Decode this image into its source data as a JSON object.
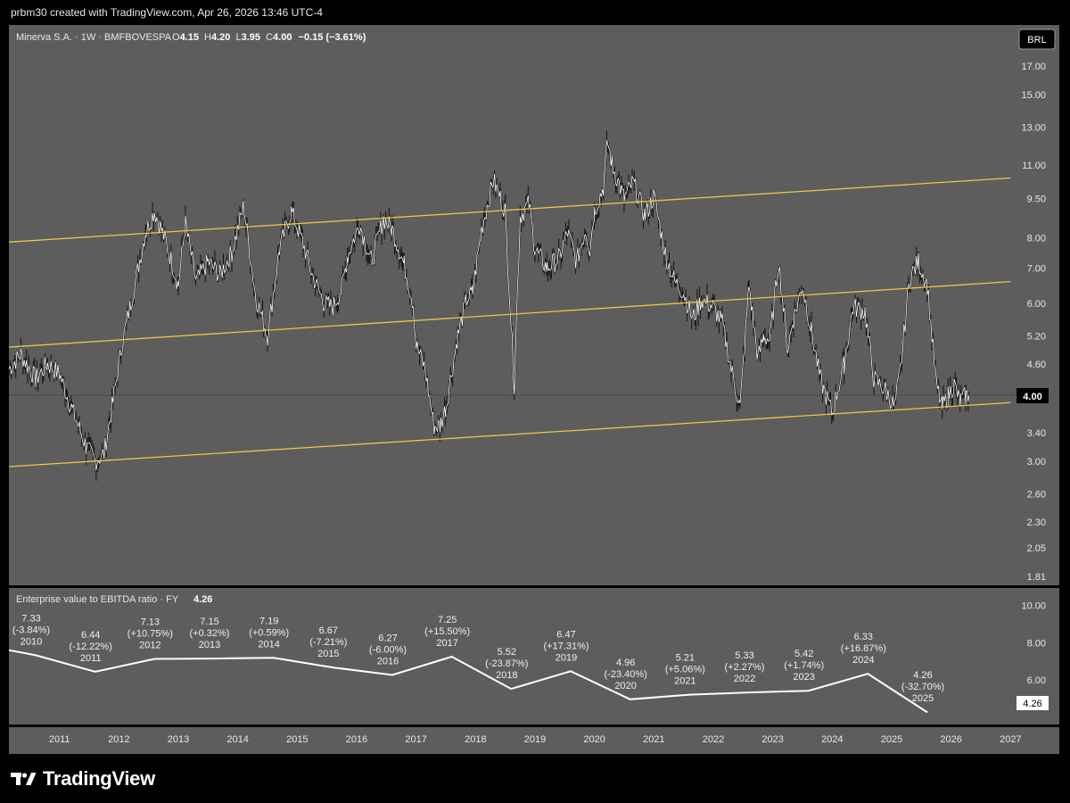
{
  "header": {
    "credit": "prbm30 created with TradingView.com, Apr 26, 2026 13:46 UTC-4"
  },
  "brand": {
    "name": "TradingView",
    "icon": "tradingview-logo-icon"
  },
  "colors": {
    "background": "#000000",
    "pane": "#5d5d5d",
    "price_line": "#ffffff",
    "candle": "#111111",
    "channel": "#e6c84a",
    "text": "#e8e8e8"
  },
  "price_pane": {
    "legend": {
      "symbol": "Minerva S.A. · 1W · BMFBOVESPA",
      "o_label": "O",
      "o_value": "4.15",
      "h_label": "H",
      "h_value": "4.20",
      "l_label": "L",
      "l_value": "3.95",
      "c_label": "C",
      "c_value": "4.00",
      "change": "−0.15 (−3.61%)"
    },
    "currency_button": "BRL",
    "last_price_label": "4.00",
    "y_ticks": [
      "17.00",
      "15.00",
      "13.00",
      "11.00",
      "9.50",
      "8.00",
      "7.00",
      "6.00",
      "5.20",
      "4.60",
      "4.00",
      "3.40",
      "3.00",
      "2.60",
      "2.30",
      "2.05",
      "1.81"
    ]
  },
  "indicator_pane": {
    "legend_name": "Enterprise value to EBITDA ratio · FY",
    "legend_value": "4.26",
    "last_value_label": "4.26",
    "y_ticks": [
      "10.00",
      "8.00",
      "6.00"
    ]
  },
  "x_ticks": [
    "2011",
    "2012",
    "2013",
    "2014",
    "2015",
    "2016",
    "2017",
    "2018",
    "2019",
    "2020",
    "2021",
    "2022",
    "2023",
    "2024",
    "2025",
    "2026",
    "2027"
  ],
  "chart_data": [
    {
      "type": "candlestick",
      "title": "Minerva S.A. · 1W · BMFBOVESPA",
      "currency": "BRL",
      "y_scale": "log",
      "ylim": [
        1.81,
        17.0
      ],
      "xlim": [
        2010.15,
        2027.1
      ],
      "grid": false,
      "last_price": 4.0,
      "price_series": {
        "x": [
          2010.15,
          2010.35,
          2010.6,
          2010.8,
          2011.0,
          2011.2,
          2011.45,
          2011.6,
          2011.75,
          2011.9,
          2012.05,
          2012.2,
          2012.45,
          2012.6,
          2012.8,
          2013.0,
          2013.12,
          2013.3,
          2013.5,
          2013.7,
          2013.9,
          2014.1,
          2014.3,
          2014.5,
          2014.7,
          2014.9,
          2015.1,
          2015.25,
          2015.45,
          2015.6,
          2015.75,
          2015.85,
          2016.05,
          2016.25,
          2016.45,
          2016.6,
          2016.8,
          2016.95,
          2017.0,
          2017.15,
          2017.3,
          2017.4,
          2017.5,
          2017.7,
          2017.85,
          2017.95,
          2018.1,
          2018.3,
          2018.5,
          2018.65,
          2018.75,
          2018.9,
          2019.0,
          2019.2,
          2019.4,
          2019.55,
          2019.7,
          2019.85,
          2019.92,
          2020.0,
          2020.15,
          2020.22,
          2020.3,
          2020.5,
          2020.65,
          2020.85,
          2021.0,
          2021.2,
          2021.35,
          2021.5,
          2021.65,
          2021.8,
          2022.0,
          2022.15,
          2022.3,
          2022.45,
          2022.6,
          2022.75,
          2022.85,
          2022.95,
          2023.1,
          2023.25,
          2023.35,
          2023.5,
          2023.65,
          2023.8,
          2024.0,
          2024.2,
          2024.35,
          2024.55,
          2024.7,
          2024.9,
          2025.05,
          2025.15,
          2025.3,
          2025.45,
          2025.6,
          2025.75,
          2025.85,
          2025.95,
          2026.05,
          2026.15,
          2026.25,
          2026.3
        ],
        "close": [
          4.5,
          4.8,
          4.3,
          4.6,
          4.4,
          3.8,
          3.2,
          3.0,
          3.1,
          3.9,
          5.0,
          6.0,
          8.2,
          9.0,
          7.8,
          6.5,
          8.5,
          6.6,
          7.2,
          6.8,
          7.5,
          9.2,
          6.2,
          5.2,
          7.6,
          9.0,
          7.8,
          6.8,
          6.0,
          5.9,
          6.4,
          7.4,
          8.5,
          7.2,
          8.7,
          8.3,
          7.1,
          6.0,
          5.0,
          4.5,
          3.5,
          3.5,
          3.8,
          5.2,
          6.1,
          6.3,
          8.3,
          10.3,
          9.0,
          4.2,
          8.8,
          9.3,
          7.6,
          7.0,
          7.3,
          8.2,
          7.2,
          8.3,
          7.6,
          9.0,
          10.0,
          12.2,
          11.0,
          9.5,
          10.2,
          8.8,
          9.6,
          7.4,
          6.6,
          6.3,
          5.6,
          6.1,
          5.9,
          5.5,
          4.5,
          3.8,
          6.5,
          4.7,
          5.2,
          5.1,
          7.2,
          4.9,
          5.6,
          6.5,
          5.3,
          4.3,
          3.7,
          4.6,
          5.9,
          5.8,
          4.3,
          4.1,
          3.8,
          4.5,
          6.7,
          7.2,
          6.5,
          4.2,
          3.8,
          4.0,
          4.2,
          3.9,
          4.0,
          4.0
        ],
        "pattern": "weekly"
      },
      "channel_lines": [
        {
          "name": "",
          "points": [
            [
              2010.15,
              7.85
            ],
            [
              2027.0,
              10.4
            ]
          ]
        },
        {
          "name": "",
          "points": [
            [
              2010.15,
              4.95
            ],
            [
              2027.0,
              6.6
            ]
          ]
        },
        {
          "name": "",
          "points": [
            [
              2010.15,
              2.93
            ],
            [
              2027.0,
              3.88
            ]
          ]
        }
      ]
    },
    {
      "type": "line",
      "title": "Enterprise value to EBITDA ratio · FY",
      "ylim": [
        3.8,
        10.8
      ],
      "x": [
        2010.15,
        2010.6,
        2011.6,
        2012.6,
        2013.6,
        2014.6,
        2015.6,
        2016.6,
        2017.6,
        2018.6,
        2019.6,
        2020.6,
        2021.6,
        2022.6,
        2023.6,
        2024.6,
        2025.6
      ],
      "y": [
        7.6,
        7.33,
        6.44,
        7.13,
        7.15,
        7.19,
        6.67,
        6.27,
        7.25,
        5.52,
        6.47,
        4.96,
        5.21,
        5.33,
        5.42,
        6.33,
        4.26
      ],
      "labels": [
        {
          "x": 2010.6,
          "value": "7.33",
          "change": "(-3.84%)",
          "year": "2010"
        },
        {
          "x": 2011.6,
          "value": "6.44",
          "change": "(-12.22%)",
          "year": "2011"
        },
        {
          "x": 2012.6,
          "value": "7.13",
          "change": "(+10.75%)",
          "year": "2012"
        },
        {
          "x": 2013.6,
          "value": "7.15",
          "change": "(+0.32%)",
          "year": "2013"
        },
        {
          "x": 2014.6,
          "value": "7.19",
          "change": "(+0.59%)",
          "year": "2014"
        },
        {
          "x": 2015.6,
          "value": "6.67",
          "change": "(-7.21%)",
          "year": "2015"
        },
        {
          "x": 2016.6,
          "value": "6.27",
          "change": "(-6.00%)",
          "year": "2016"
        },
        {
          "x": 2017.6,
          "value": "7.25",
          "change": "(+15.50%)",
          "year": "2017"
        },
        {
          "x": 2018.6,
          "value": "5.52",
          "change": "(-23.87%)",
          "year": "2018"
        },
        {
          "x": 2019.6,
          "value": "6.47",
          "change": "(+17.31%)",
          "year": "2019"
        },
        {
          "x": 2020.6,
          "value": "4.96",
          "change": "(-23.40%)",
          "year": "2020"
        },
        {
          "x": 2021.6,
          "value": "5.21",
          "change": "(+5.06%)",
          "year": "2021"
        },
        {
          "x": 2022.6,
          "value": "5.33",
          "change": "(+2.27%)",
          "year": "2022"
        },
        {
          "x": 2023.6,
          "value": "5.42",
          "change": "(+1.74%)",
          "year": "2023"
        },
        {
          "x": 2024.6,
          "value": "6.33",
          "change": "(+16.87%)",
          "year": "2024"
        },
        {
          "x": 2025.6,
          "value": "4.26",
          "change": "(-32.70%)",
          "year": "2025"
        }
      ]
    }
  ]
}
